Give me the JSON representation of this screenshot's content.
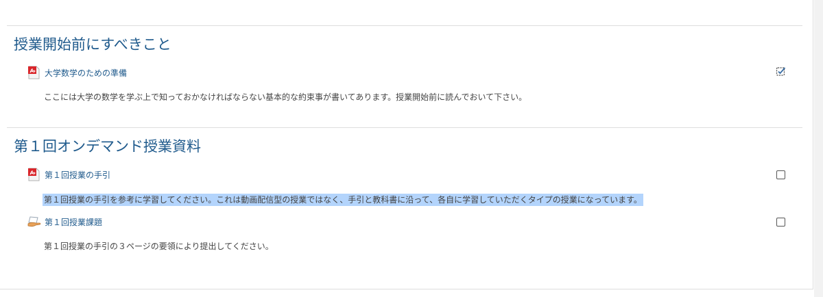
{
  "sections": [
    {
      "title": "授業開始前にすべきこと",
      "activities": [
        {
          "icon": "pdf-file-icon",
          "label": "大学数学のための準備",
          "description": "ここには大学の数学を学ぶ上で知っておかなければならない基本的な約束事が書いてあります。授業開始前に読んでおいて下さい。",
          "completed": true
        }
      ]
    },
    {
      "title": "第１回オンデマンド授業資料",
      "activities": [
        {
          "icon": "pdf-file-icon",
          "label": "第１回授業の手引",
          "description": "第１回授業の手引を参考に学習してください。これは動画配信型の授業ではなく、手引と教科書に沿って、各自に学習していただくタイプの授業になっています。",
          "completed": false,
          "description_selected": true
        },
        {
          "icon": "assignment-hand-icon",
          "label": "第１回授業課題",
          "description": "第１回授業の手引の３ページの要領により提出してください。",
          "completed": false
        }
      ]
    }
  ],
  "colors": {
    "link": "#1f5a8c",
    "selection": "#b3d4fc",
    "divider": "#dddddd"
  }
}
